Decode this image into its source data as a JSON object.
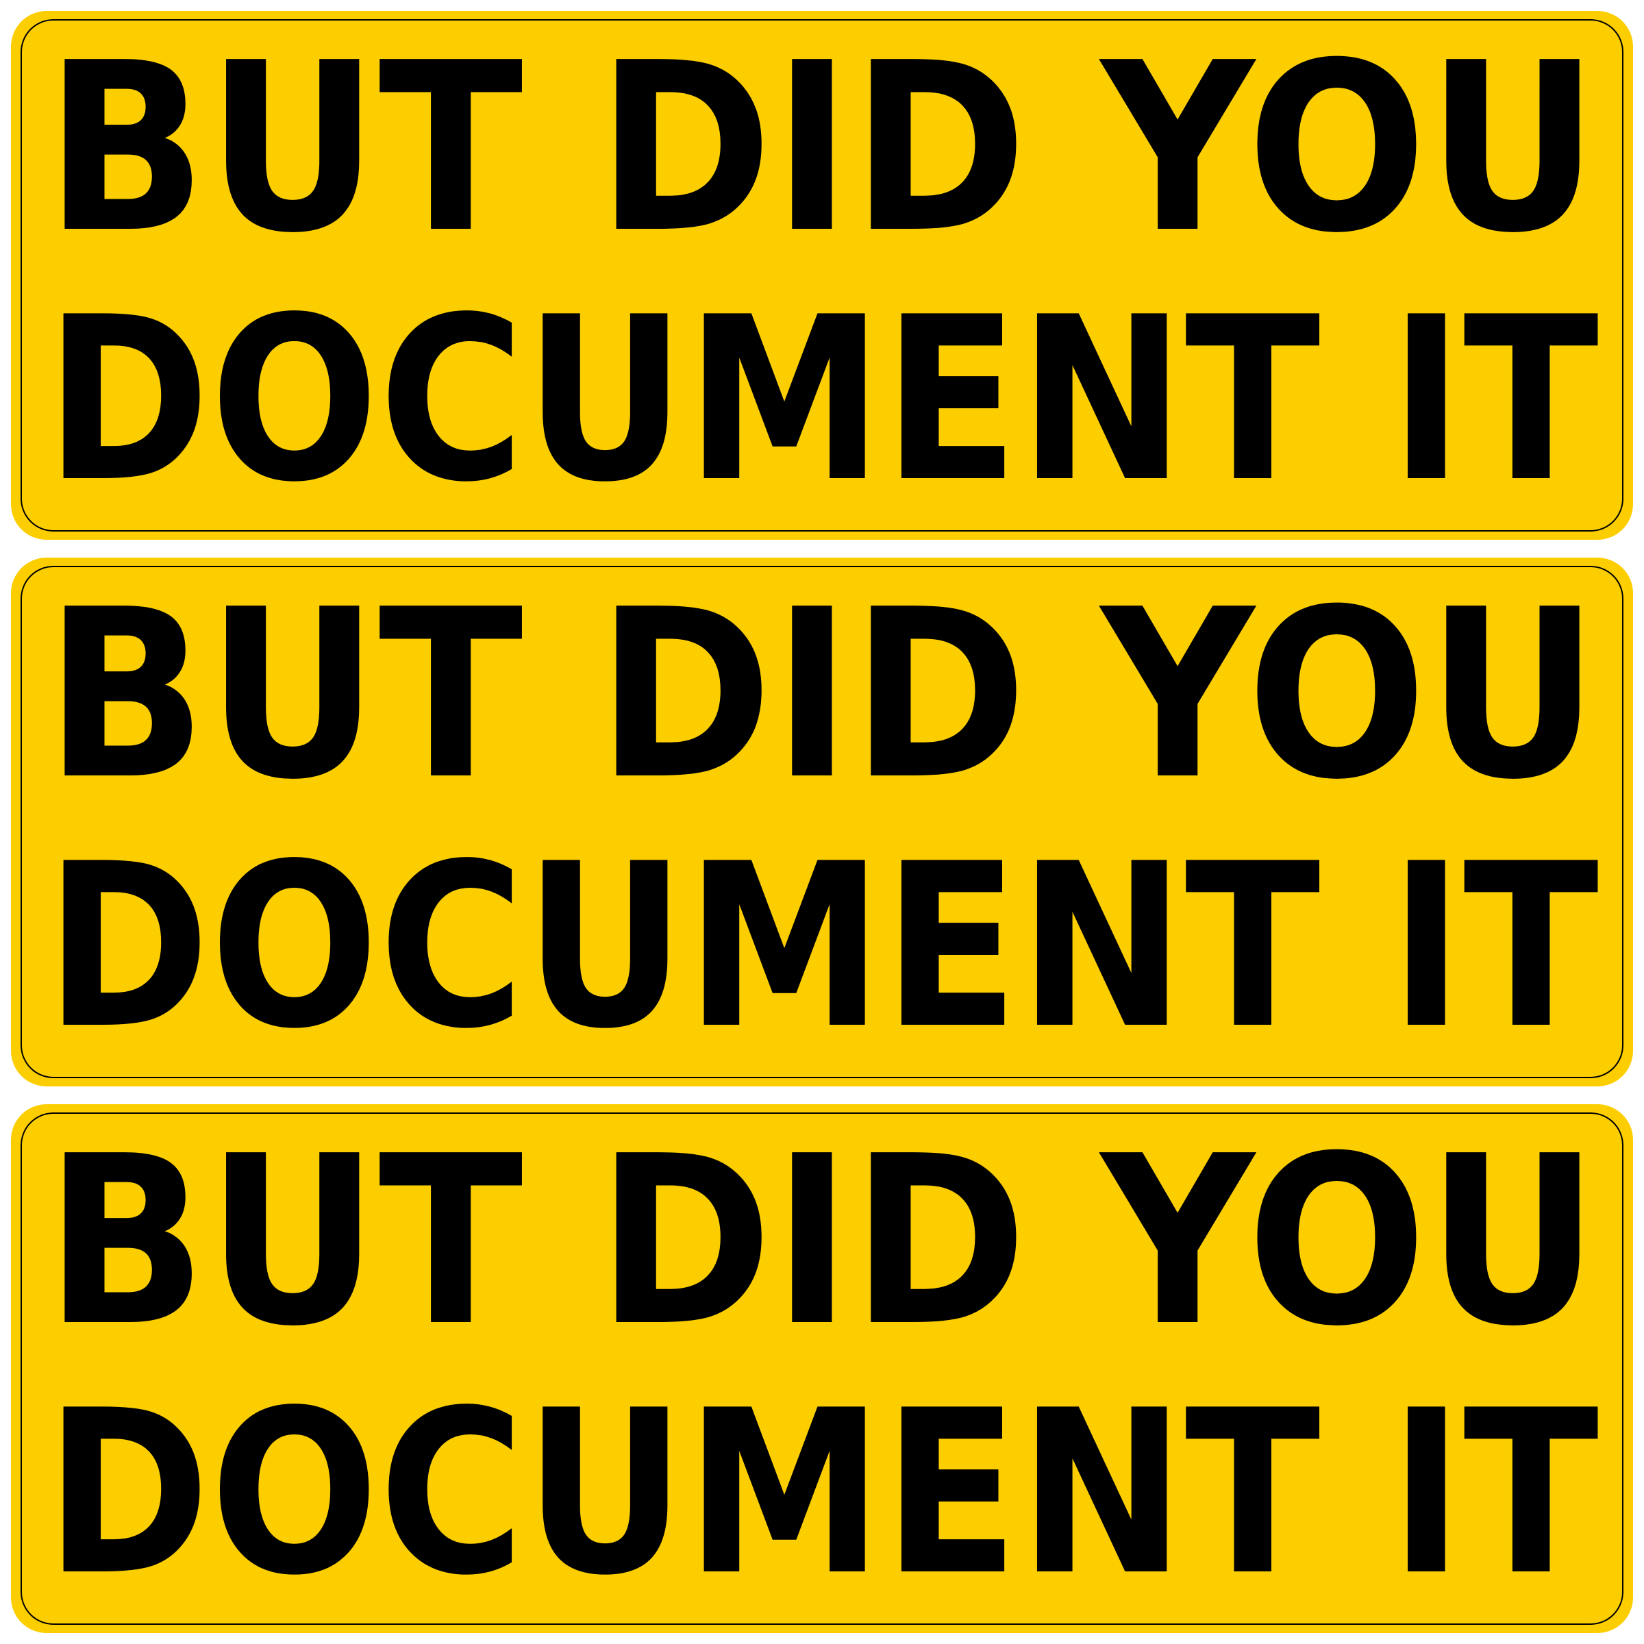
{
  "colors": {
    "sign_background": "#FCCE00",
    "text": "#000000",
    "border": "#000000",
    "page_background": "#FFFFFF"
  },
  "signs": [
    {
      "line1": "BUT DID YOU",
      "line2": "DOCUMENT IT"
    },
    {
      "line1": "BUT DID YOU",
      "line2": "DOCUMENT IT"
    },
    {
      "line1": "BUT DID YOU",
      "line2": "DOCUMENT IT"
    }
  ]
}
